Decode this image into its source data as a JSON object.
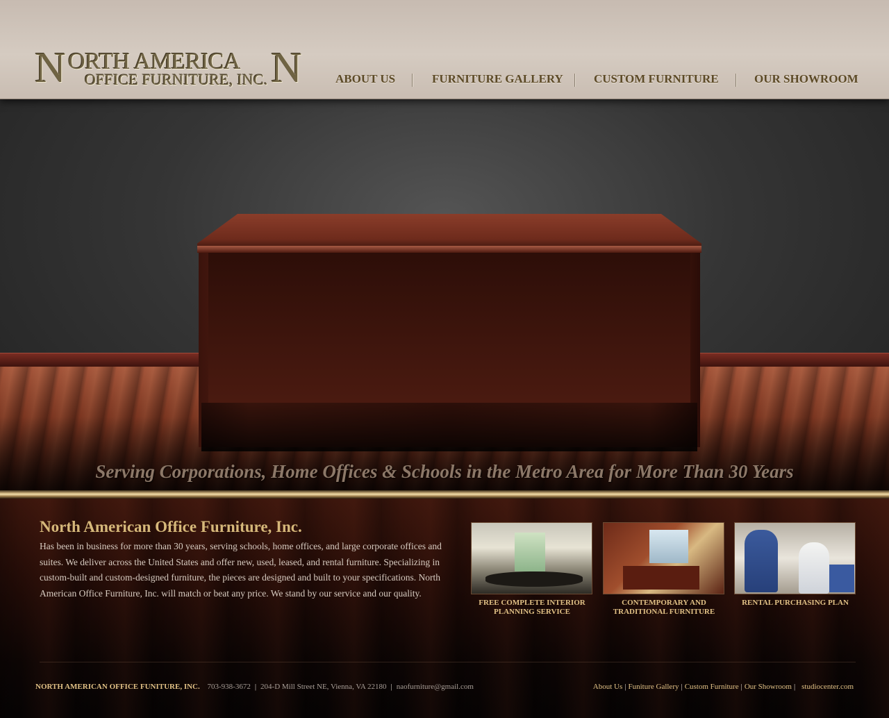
{
  "header": {
    "logo": {
      "line1": "ORTH AMERICA",
      "line2": "OFFICE FURNITURE, INC.",
      "big_letter_left": "N",
      "big_letter_right": "N"
    },
    "nav": [
      {
        "label": "ABOUT US"
      },
      {
        "label": "FURNITURE GALLERY"
      },
      {
        "label": "CUSTOM FURNITURE"
      },
      {
        "label": "OUR SHOWROOM"
      }
    ]
  },
  "hero": {
    "tagline": "Serving Corporations, Home Offices & Schools in the Metro Area for More Than 30 Years"
  },
  "intro": {
    "title": "North American Office Furniture, Inc.",
    "text": "Has been in business for more than 30 years, serving schools, home offices, and large corporate offices and suites. We deliver across the United States and offer new, used, leased, and rental furniture. Specializing in custom-built and custom-designed furniture, the pieces are designed and built to your specifications. North American Office Furniture, Inc. will match or beat any price. We stand by our service and our quality."
  },
  "features": [
    {
      "caption": "FREE COMPLETE INTERIOR PLANNING SERVICE"
    },
    {
      "caption": "CONTEMPORARY AND TRADITIONAL FURNITURE"
    },
    {
      "caption": "RENTAL PURCHASING PLAN"
    }
  ],
  "footer": {
    "company": "NORTH AMERICAN OFFICE FUNITURE, INC.",
    "phone": "703-938-3672",
    "address": "204-D Mill Street NE, Vienna, VA 22180",
    "email": "naofurniture@gmail.com",
    "links": [
      {
        "label": "About Us"
      },
      {
        "label": "Funiture Gallery"
      },
      {
        "label": "Custom Furniture"
      },
      {
        "label": "Our Showroom"
      }
    ],
    "credit": "studiocenter.com"
  },
  "colors": {
    "gold": "#e1c186",
    "nav_text": "#5c4a27",
    "header_bg": "#d0c5bb"
  }
}
